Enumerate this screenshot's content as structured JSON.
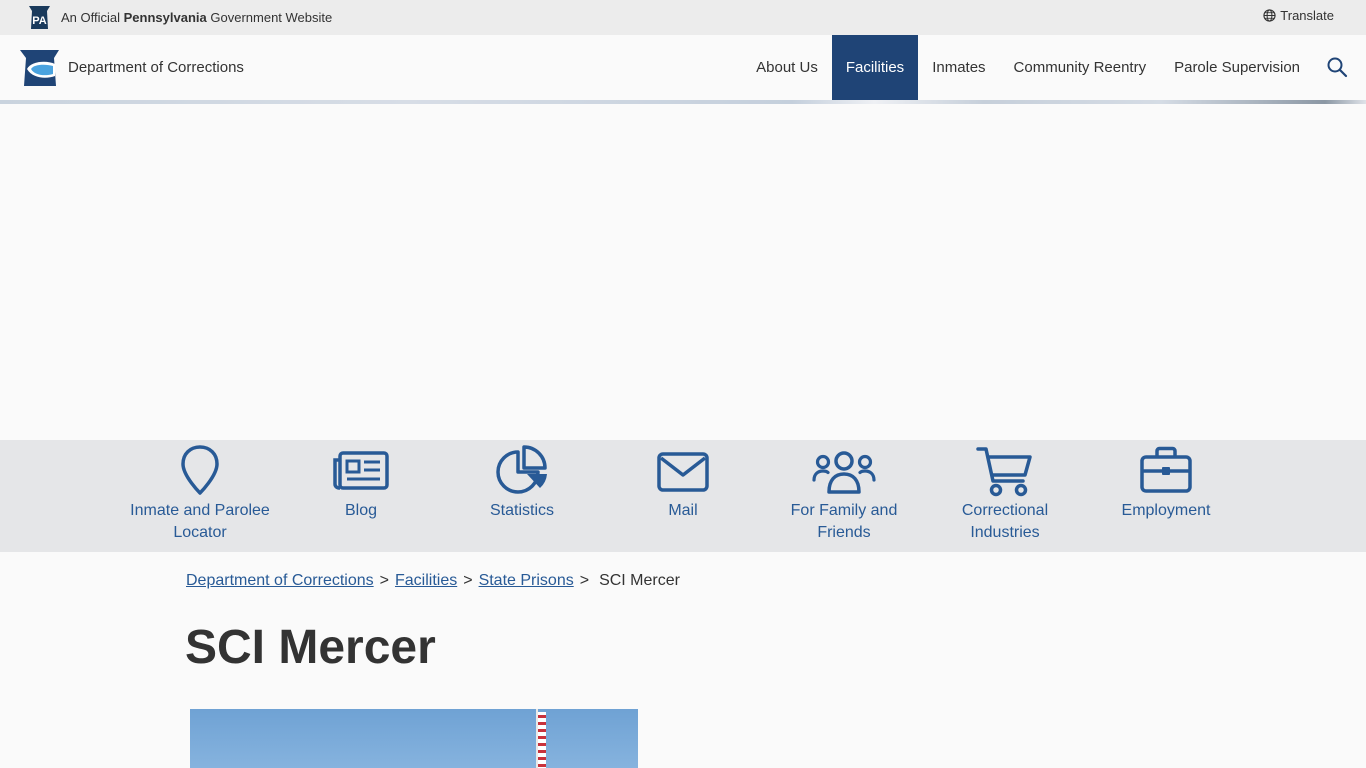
{
  "gov_bar": {
    "badge": "PA",
    "official_prefix": "An Official",
    "official_state": "Pennsylvania",
    "official_suffix": "Government Website",
    "translate": "Translate"
  },
  "header": {
    "department": "Department of Corrections",
    "nav": [
      {
        "label": "About Us",
        "active": false
      },
      {
        "label": "Facilities",
        "active": true
      },
      {
        "label": "Inmates",
        "active": false
      },
      {
        "label": "Community Reentry",
        "active": false
      },
      {
        "label": "Parole Supervision",
        "active": false
      }
    ]
  },
  "quick_links": [
    {
      "label": "Inmate and Parolee Locator",
      "icon": "map-pin-icon"
    },
    {
      "label": "Blog",
      "icon": "newspaper-icon"
    },
    {
      "label": "Statistics",
      "icon": "pie-chart-icon"
    },
    {
      "label": "Mail",
      "icon": "envelope-icon"
    },
    {
      "label": "For Family and Friends",
      "icon": "users-icon"
    },
    {
      "label": "Correctional Industries",
      "icon": "shopping-cart-icon"
    },
    {
      "label": "Employment",
      "icon": "briefcase-icon"
    }
  ],
  "breadcrumb": {
    "links": [
      "Department of Corrections",
      "Facilities",
      "State Prisons"
    ],
    "current": "SCI Mercer"
  },
  "page_title": "SCI Mercer",
  "colors": {
    "brand_blue": "#1f4476",
    "link_blue": "#285a96",
    "quicklinks_bg": "#e5e6e8"
  }
}
